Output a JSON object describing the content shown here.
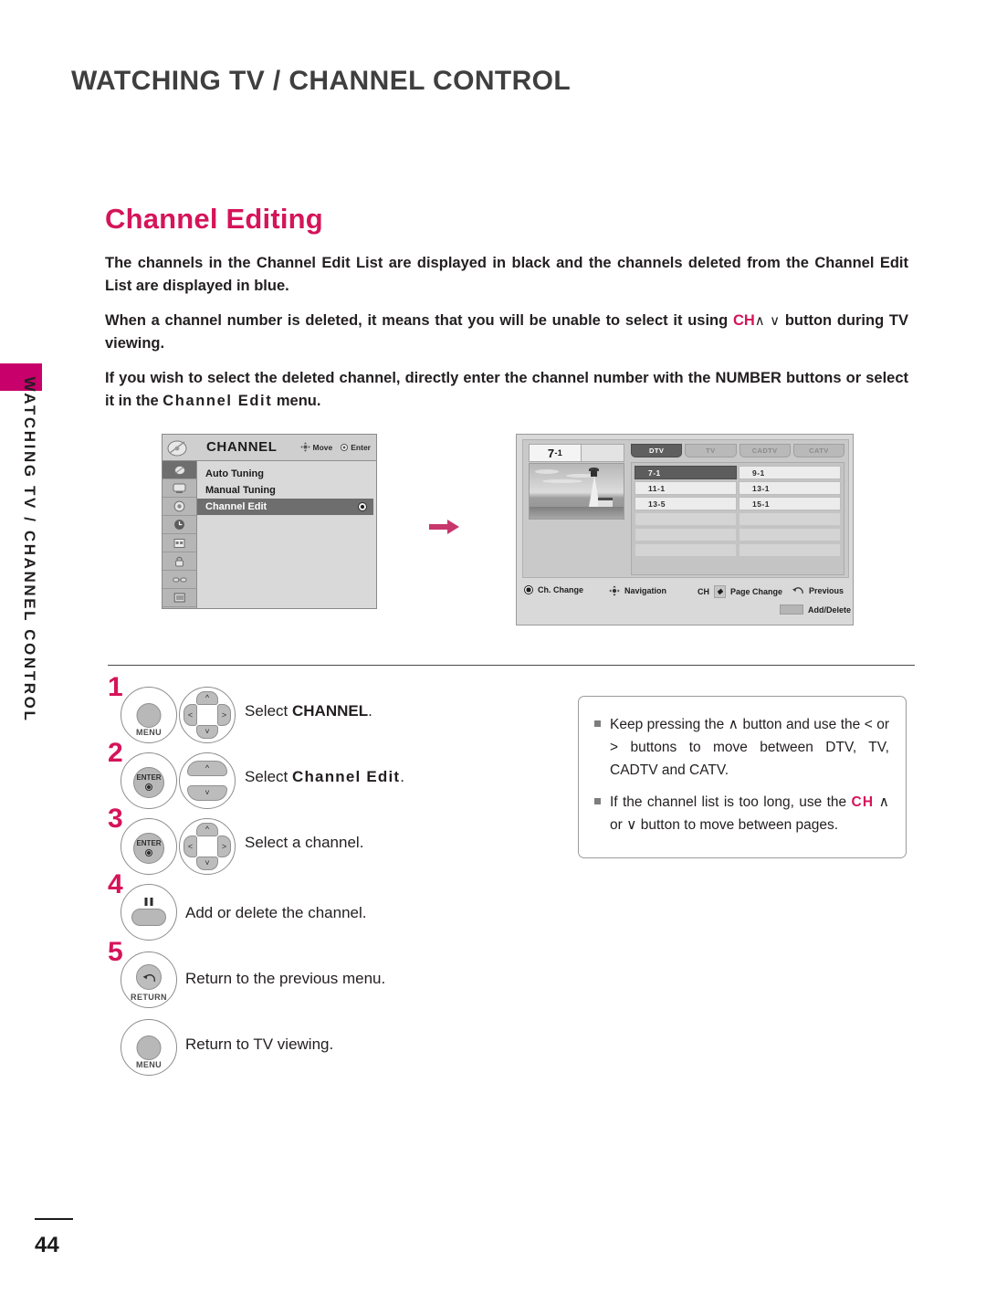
{
  "running_head": "WATCHING TV / CHANNEL CONTROL",
  "side_tab": {
    "label": "WATCHING TV / CHANNEL CONTROL",
    "color": "#c8006b"
  },
  "heading": "Channel Editing",
  "accent_color": "#d5145a",
  "body": {
    "p1": "The channels in the Channel Edit List are displayed in black and the channels deleted from the Channel Edit List are displayed in blue.",
    "p2_a": "When a channel number is deleted, it means that you will be unable to select it using ",
    "p2_ch": "CH",
    "p2_arrows": "∧ ∨",
    "p2_b": " button during TV viewing.",
    "p3_a": "If you wish to select the deleted channel, directly enter the channel number with the NUMBER buttons or select it in the ",
    "p3_bold": "Channel Edit",
    "p3_b": " menu."
  },
  "osd_menu": {
    "title": "CHANNEL",
    "hint_move": "Move",
    "hint_enter": "Enter",
    "header_icon": "satellite-dish-icon",
    "sidebar_icons": [
      "dish-icon",
      "picture-icon",
      "audio-icon",
      "time-icon",
      "option-icon",
      "lock-icon",
      "input-icon",
      "usb-icon"
    ],
    "items": [
      {
        "label": "Auto Tuning",
        "selected": false
      },
      {
        "label": "Manual Tuning",
        "selected": false
      },
      {
        "label": "Channel Edit",
        "selected": true
      }
    ]
  },
  "flow_arrow": {
    "name": "right-arrow-icon",
    "color": "#c8376b"
  },
  "osd_list": {
    "preview_channel": "7",
    "preview_channel_sub": "-1",
    "tabs": [
      {
        "label": "DTV",
        "active": true
      },
      {
        "label": "TV",
        "active": false
      },
      {
        "label": "CADTV",
        "active": false
      },
      {
        "label": "CATV",
        "active": false
      }
    ],
    "grid_rows": [
      [
        {
          "label": "7-1",
          "selected": true
        },
        {
          "label": "9-1",
          "selected": false
        }
      ],
      [
        {
          "label": "11-1",
          "selected": false
        },
        {
          "label": "13-1",
          "selected": false
        }
      ],
      [
        {
          "label": "13-5",
          "selected": false
        },
        {
          "label": "15-1",
          "selected": false
        }
      ]
    ],
    "legend": {
      "ch_change": "Ch. Change",
      "navigation": "Navigation",
      "ch_prefix": "CH",
      "page_change": "Page Change",
      "previous": "Previous",
      "add_delete": "Add/Delete"
    }
  },
  "steps": [
    {
      "num": "1",
      "key_label": "MENU",
      "key_type": "round",
      "pad": "dpad",
      "text_pre": "Select ",
      "text_bold": "CHANNEL",
      "text_post": "."
    },
    {
      "num": "2",
      "key_label": "ENTER",
      "key_type": "enter",
      "pad": "updown",
      "text_pre": "Select ",
      "text_bold": "Channel Edit",
      "text_post": "."
    },
    {
      "num": "3",
      "key_label": "ENTER",
      "key_type": "enter",
      "pad": "dpad",
      "text_pre": "Select a channel.",
      "text_bold": "",
      "text_post": ""
    },
    {
      "num": "4",
      "key_label": "",
      "key_type": "bar",
      "pad": "",
      "text_pre": "Add or delete the channel.",
      "text_bold": "",
      "text_post": ""
    },
    {
      "num": "5",
      "key_label": "RETURN",
      "key_type": "return",
      "pad": "",
      "text_pre": "Return to the previous menu.",
      "text_bold": "",
      "text_post": ""
    },
    {
      "num": "",
      "key_label": "MENU",
      "key_type": "round",
      "pad": "",
      "text_pre": "Return to TV viewing.",
      "text_bold": "",
      "text_post": ""
    }
  ],
  "note": {
    "item1_a": "Keep pressing the ",
    "item1_up": "∧",
    "item1_b": " button and use the ",
    "item1_left": "<",
    "item1_or": " or ",
    "item1_right": ">",
    "item1_c": " buttons to move between DTV, TV, CADTV and CATV.",
    "item2_a": "If the channel list is too long, use the ",
    "item2_ch": "CH",
    "item2_up": "∧",
    "item2_or": " or ",
    "item2_down": "∨",
    "item2_b": " button to move between pages."
  },
  "page_number": "44"
}
